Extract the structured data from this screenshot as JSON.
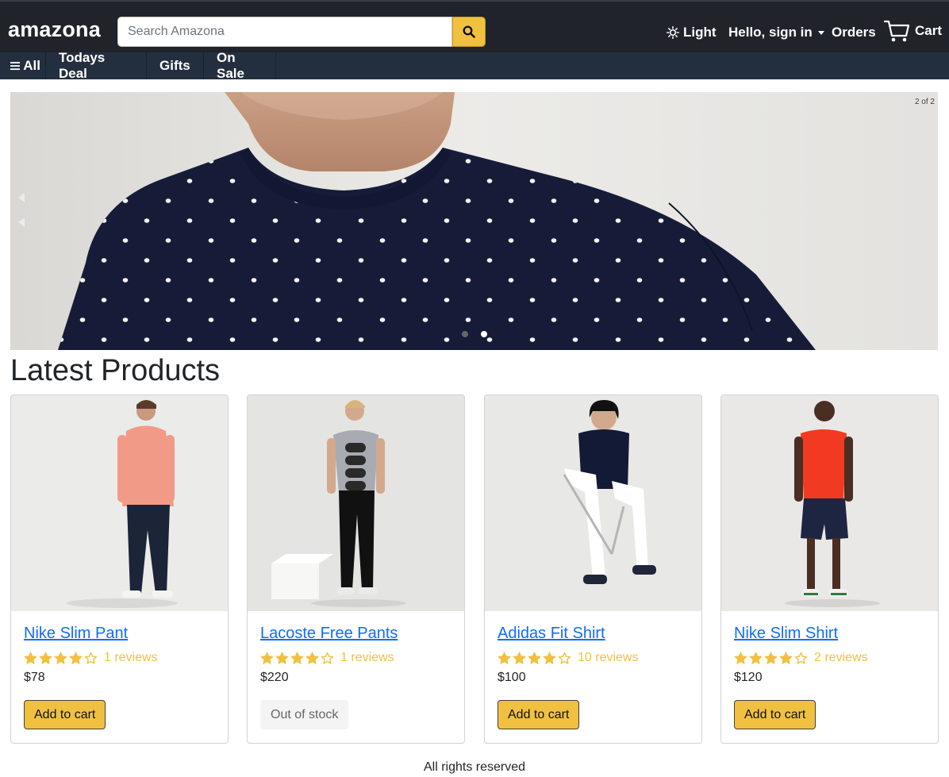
{
  "header": {
    "brand": "amazona",
    "search_placeholder": "Search Amazona",
    "theme_label": "Light",
    "signin_label": "Hello, sign in",
    "orders_label": "Orders",
    "cart_label": "Cart"
  },
  "subnav": {
    "all_label": "All",
    "items": [
      "Todays Deal",
      "Gifts",
      "On Sale"
    ]
  },
  "carousel": {
    "counter": "2 of 2",
    "active_index": 2,
    "total": 2
  },
  "section_title": "Latest Products",
  "products": [
    {
      "name": "Nike Slim Pant",
      "rating": 4,
      "reviews": "1 reviews",
      "price": "$78",
      "action": "Add to cart",
      "in_stock": true
    },
    {
      "name": "Lacoste Free Pants",
      "rating": 4,
      "reviews": "1 reviews",
      "price": "$220",
      "action": "Out of stock",
      "in_stock": false
    },
    {
      "name": "Adidas Fit Shirt",
      "rating": 4,
      "reviews": "10 reviews",
      "price": "$100",
      "action": "Add to cart",
      "in_stock": true
    },
    {
      "name": "Nike Slim Shirt",
      "rating": 4,
      "reviews": "2 reviews",
      "price": "$120",
      "action": "Add to cart",
      "in_stock": true
    }
  ],
  "footer": "All rights reserved",
  "colors": {
    "header_bg": "#20232a",
    "subnav_bg": "#232f3e",
    "accent": "#f0c040",
    "link": "#0d6efd"
  },
  "icons": [
    "search-icon",
    "sun-icon",
    "cart-icon",
    "menu-icon",
    "star-icon"
  ]
}
